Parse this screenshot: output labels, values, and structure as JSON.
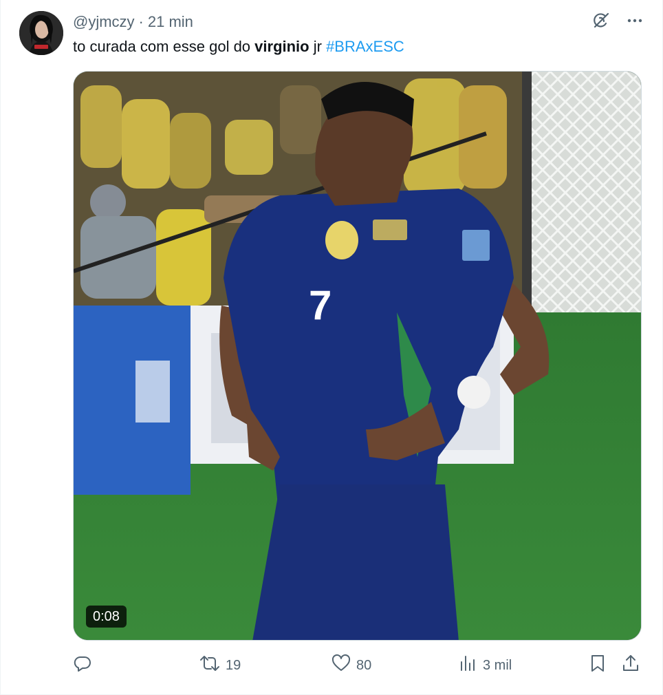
{
  "tweet": {
    "handle": "@yjmczy",
    "separator": "·",
    "time": "21 min",
    "text_parts": {
      "before": "to curada com esse gol do ",
      "bold": "virginio",
      "middle": " jr ",
      "hashtag": "#BRAxESC"
    }
  },
  "media": {
    "duration": "0:08",
    "jersey_number": "7"
  },
  "actions": {
    "retweets": "19",
    "likes": "80",
    "views": "3 mil"
  },
  "icons": {
    "top_right": [
      "grok-icon",
      "more-icon"
    ],
    "action_bar": [
      "reply-icon",
      "retweet-icon",
      "like-icon",
      "views-icon",
      "bookmark-icon",
      "share-icon"
    ]
  },
  "colors": {
    "accent": "#1d9bf0",
    "muted_text": "#536471",
    "text": "#0f1419"
  }
}
